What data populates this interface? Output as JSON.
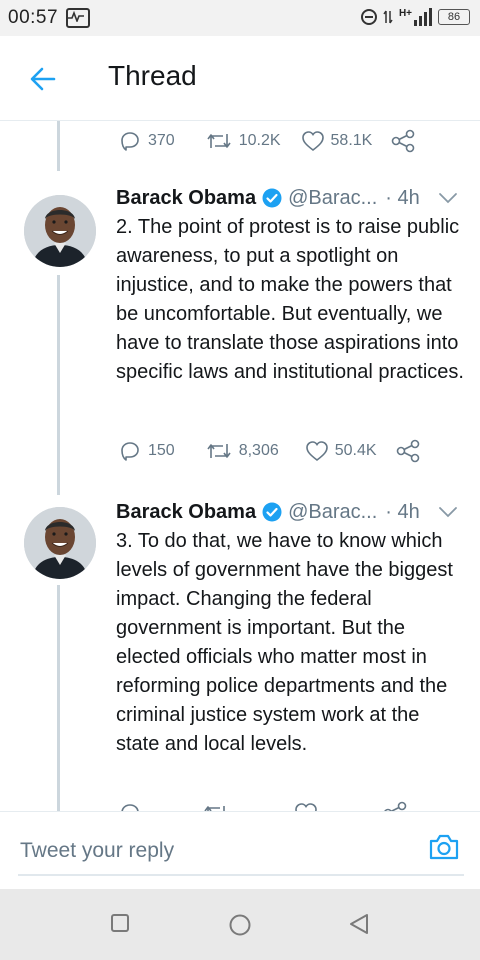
{
  "status_bar": {
    "time": "00:57",
    "network": "H+",
    "battery": "86"
  },
  "header": {
    "title": "Thread"
  },
  "top_actions": {
    "replies": "370",
    "retweets": "10.2K",
    "likes": "58.1K"
  },
  "tweets": [
    {
      "name": "Barack Obama",
      "handle": "@Barac...",
      "time": "· 4h",
      "text": "2. The point of protest is to raise public awareness, to put a spotlight on injustice, and to make the powers that be uncomfortable. But eventually, we have to translate those aspirations into specific laws and institutional practices.",
      "replies": "150",
      "retweets": "8,306",
      "likes": "50.4K"
    },
    {
      "name": "Barack Obama",
      "handle": "@Barac...",
      "time": "· 4h",
      "text": "3. To do that, we have to know which levels of government have the biggest impact. Changing the federal government is important. But the elected officials who matter most in reforming police departments and the criminal justice system work at the state and local levels."
    }
  ],
  "reply_bar": {
    "placeholder": "Tweet your reply"
  },
  "colors": {
    "accent": "#1da1f2",
    "muted": "#657786",
    "text": "#14171a",
    "divider": "#e6ecf0"
  },
  "icons": [
    "back-arrow-icon",
    "reply-icon",
    "retweet-icon",
    "like-icon",
    "share-icon",
    "verified-icon",
    "chevron-down-icon",
    "camera-icon",
    "nav-recents-icon",
    "nav-home-icon",
    "nav-back-icon"
  ]
}
